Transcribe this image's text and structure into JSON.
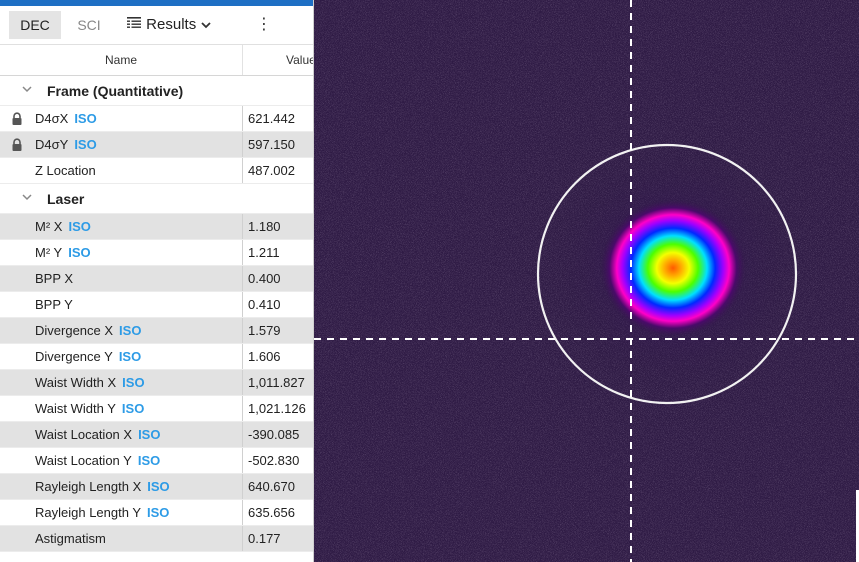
{
  "toolbar": {
    "dec_label": "DEC",
    "sci_label": "SCI",
    "results_label": "Results",
    "more_icon": "⋮"
  },
  "table": {
    "col_name": "Name",
    "col_value": "Value"
  },
  "groups": {
    "frame": {
      "label": "Frame (Quantitative)",
      "rows": [
        {
          "name": "D4σX",
          "iso": "ISO",
          "value": "621.442"
        },
        {
          "name": "D4σY",
          "iso": "ISO",
          "value": "597.150"
        },
        {
          "name": "Z Location",
          "value": "487.002"
        }
      ]
    },
    "laser": {
      "label": "Laser",
      "rows": [
        {
          "name": "M² X",
          "iso": "ISO",
          "value": "1.180"
        },
        {
          "name": "M² Y",
          "iso": "ISO",
          "value": "1.211"
        },
        {
          "name": "BPP X",
          "value": "0.400"
        },
        {
          "name": "BPP Y",
          "value": "0.410"
        },
        {
          "name": "Divergence X",
          "iso": "ISO",
          "value": "1.579"
        },
        {
          "name": "Divergence Y",
          "iso": "ISO",
          "value": "1.606"
        },
        {
          "name": "Waist Width X",
          "iso": "ISO",
          "value": "1,011.827"
        },
        {
          "name": "Waist Width Y",
          "iso": "ISO",
          "value": "1,021.126"
        },
        {
          "name": "Waist Location X",
          "iso": "ISO",
          "value": "-390.085"
        },
        {
          "name": "Waist Location Y",
          "iso": "ISO",
          "value": "-502.830"
        },
        {
          "name": "Rayleigh Length X",
          "iso": "ISO",
          "value": "640.670"
        },
        {
          "name": "Rayleigh Length Y",
          "iso": "ISO",
          "value": "635.656"
        },
        {
          "name": "Astigmatism",
          "value": "0.177"
        }
      ]
    }
  },
  "colors": {
    "accent": "#1e6fc4",
    "iso": "#2d9be6",
    "row_alt": "#e2e2e2",
    "beam_background": "#2f1b45"
  }
}
